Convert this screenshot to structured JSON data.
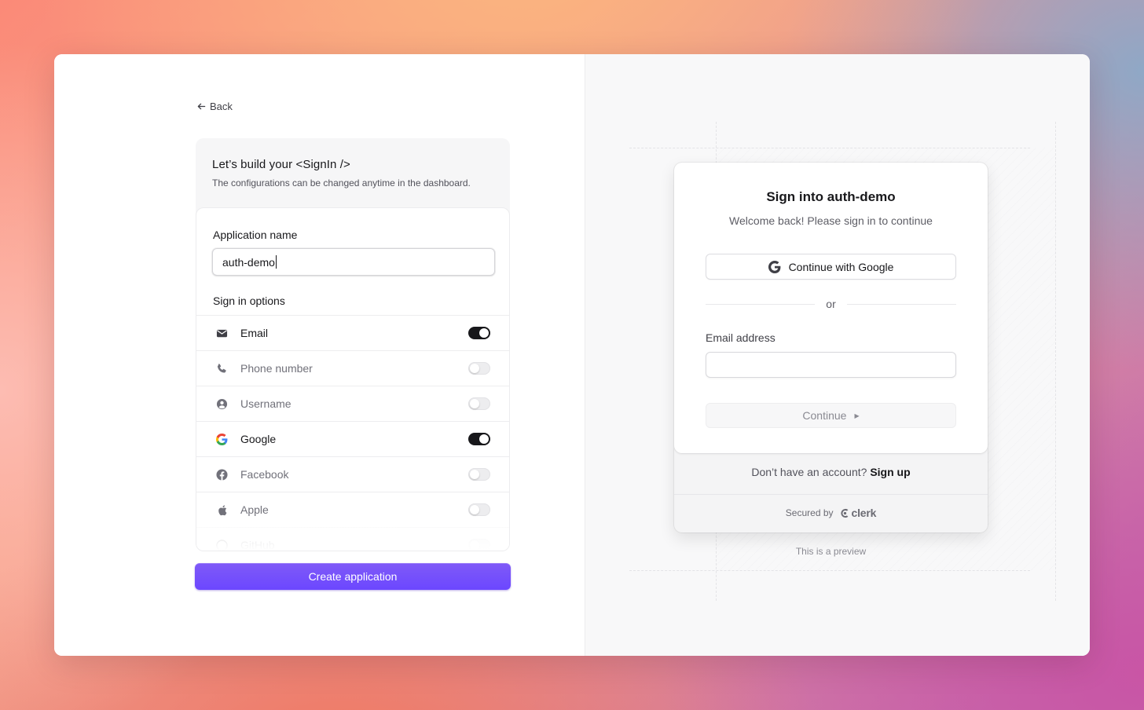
{
  "builder": {
    "back_label": "Back",
    "title": "Let’s build your <SignIn />",
    "subtitle": "The configurations can be changed anytime in the dashboard.",
    "app_name_label": "Application name",
    "app_name_value": "auth-demo",
    "sign_in_options_label": "Sign in options",
    "options": [
      {
        "label": "Email",
        "icon": "mail-icon",
        "enabled": true
      },
      {
        "label": "Phone number",
        "icon": "phone-icon",
        "enabled": false
      },
      {
        "label": "Username",
        "icon": "user-circle-icon",
        "enabled": false
      },
      {
        "label": "Google",
        "icon": "google-icon",
        "enabled": true
      },
      {
        "label": "Facebook",
        "icon": "facebook-icon",
        "enabled": false
      },
      {
        "label": "Apple",
        "icon": "apple-icon",
        "enabled": false
      },
      {
        "label": "GitHub",
        "icon": "github-icon",
        "enabled": false
      }
    ],
    "create_button": "Create application"
  },
  "preview": {
    "title": "Sign into auth-demo",
    "subtitle": "Welcome back! Please sign in to continue",
    "google_button": "Continue with Google",
    "divider_text": "or",
    "email_label": "Email address",
    "email_value": "",
    "continue_button": "Continue",
    "no_account_text": "Don’t have an account?",
    "sign_up_link": "Sign up",
    "secured_by": "Secured by",
    "brand": "clerk",
    "note": "This is a preview"
  },
  "colors": {
    "accent": "#6c47ff",
    "toggle_on": "#18181b",
    "toggle_off": "#ededef"
  }
}
